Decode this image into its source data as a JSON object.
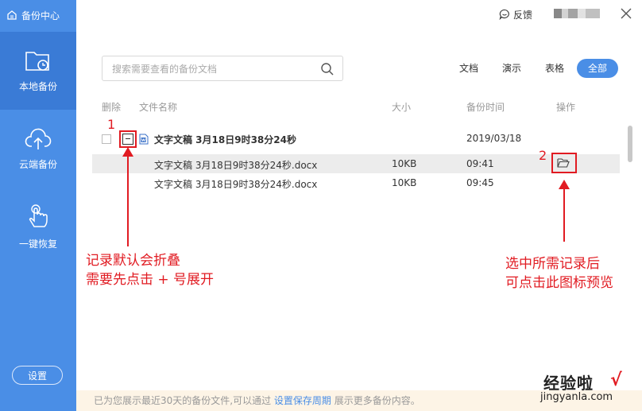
{
  "app": {
    "title": "备份中心"
  },
  "sidebar": {
    "items": [
      {
        "label": "本地备份",
        "icon": "folder-clock-icon",
        "active": true
      },
      {
        "label": "云端备份",
        "icon": "cloud-upload-icon",
        "active": false
      },
      {
        "label": "一键恢复",
        "icon": "hand-touch-icon",
        "active": false
      }
    ],
    "settings_label": "设置"
  },
  "header": {
    "feedback_label": "反馈"
  },
  "search": {
    "placeholder": "搜索需要查看的备份文档"
  },
  "filters": [
    {
      "label": "文档",
      "active": false
    },
    {
      "label": "演示",
      "active": false
    },
    {
      "label": "表格",
      "active": false
    },
    {
      "label": "全部",
      "active": true
    }
  ],
  "table": {
    "headers": {
      "delete": "删除",
      "name": "文件名称",
      "size": "大小",
      "time": "备份时间",
      "action": "操作"
    },
    "group": {
      "title": "文字文稿 3月18日9时38分24秒",
      "date": "2019/03/18"
    },
    "rows": [
      {
        "name": "文字文稿 3月18日9时38分24秒.docx",
        "size": "10KB",
        "time": "09:41"
      },
      {
        "name": "文字文稿 3月18日9时38分24秒.docx",
        "size": "10KB",
        "time": "09:45"
      }
    ]
  },
  "annotations": {
    "num1": "1",
    "num2": "2",
    "note_left_1": "记录默认会折叠",
    "note_left_2": "需要先点击 + 号展开",
    "note_right_1": "选中所需记录后",
    "note_right_2": "可点击此图标预览"
  },
  "footer": {
    "text_before": "已为您展示最近30天的备份文件,可以通过 ",
    "link": "设置保存周期",
    "text_after": " 展示更多备份内容。"
  },
  "watermark": {
    "title": "经验啦",
    "check": "√",
    "url": "jingyanla.com"
  },
  "colors": {
    "accent": "#4a8ee6",
    "annotation": "#e11b22",
    "footer_bg": "#fdf4e6"
  }
}
